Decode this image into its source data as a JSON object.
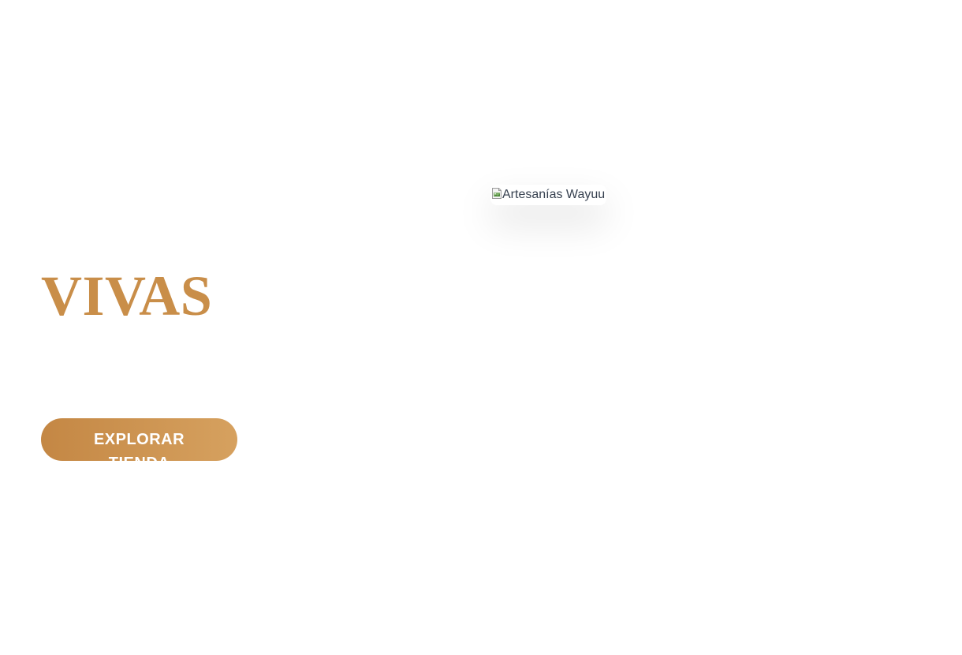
{
  "hero": {
    "heading_word": "VIVAS",
    "cta_label": "EXPLORAR TIENDA",
    "image_alt": "Artesanías Wayuu",
    "image_icon": "broken-image-icon"
  },
  "colors": {
    "accent": "#c98e49",
    "button_gradient_start": "#c48744",
    "button_gradient_end": "#d6a15f",
    "button_text": "#ffffff",
    "alt_text": "#374150",
    "background": "#ffffff"
  }
}
